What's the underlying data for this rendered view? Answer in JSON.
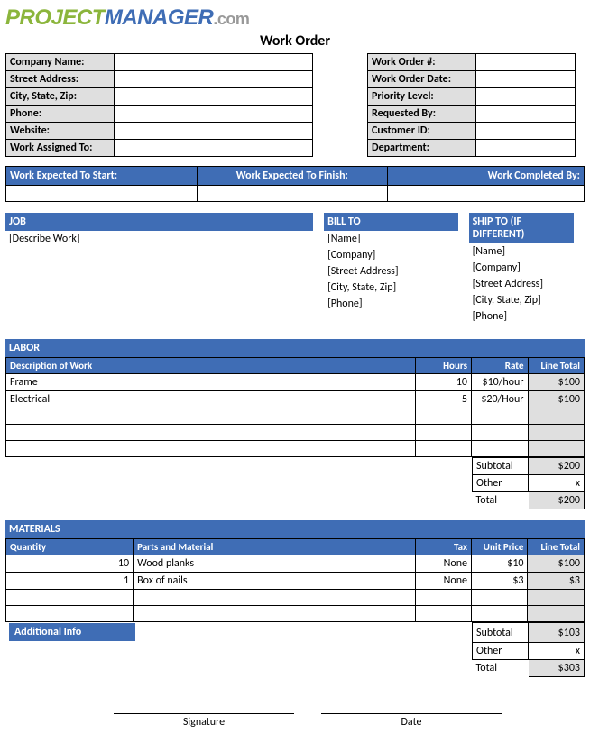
{
  "logo": {
    "p1": "PROJECT",
    "p2": "MANAGER",
    "p3": ".com"
  },
  "title": "Work Order",
  "left_info": [
    {
      "label": "Company Name:",
      "value": ""
    },
    {
      "label": "Street Address:",
      "value": ""
    },
    {
      "label": "City, State, Zip:",
      "value": ""
    },
    {
      "label": "Phone:",
      "value": ""
    },
    {
      "label": "Website:",
      "value": ""
    },
    {
      "label": "Work Assigned To:",
      "value": ""
    }
  ],
  "right_info": [
    {
      "label": "Work Order #:",
      "value": ""
    },
    {
      "label": "Work Order Date:",
      "value": ""
    },
    {
      "label": "Priority Level:",
      "value": ""
    },
    {
      "label": "Requested By:",
      "value": ""
    },
    {
      "label": "Customer ID:",
      "value": ""
    },
    {
      "label": "Department:",
      "value": ""
    }
  ],
  "timeline": {
    "h1": "Work Expected To Start:",
    "h2": "Work Expected To Finish:",
    "h3": "Work Completed By:"
  },
  "job": {
    "header": "JOB",
    "line": "[Describe Work]"
  },
  "billto": {
    "header": "BILL TO",
    "l1": "[Name]",
    "l2": "[Company]",
    "l3": "[Street Address]",
    "l4": "[City, State, Zip]",
    "l5": "[Phone]"
  },
  "shipto": {
    "header": "SHIP TO (IF DIFFERENT)",
    "l1": "[Name]",
    "l2": "[Company]",
    "l3": "[Street Address]",
    "l4": "[City, State, Zip]",
    "l5": "[Phone]"
  },
  "labor": {
    "title": "LABOR",
    "cols": {
      "desc": "Description of Work",
      "hours": "Hours",
      "rate": "Rate",
      "total": "Line Total"
    },
    "rows": [
      {
        "desc": "Frame",
        "hours": "10",
        "rate": "$10/hour",
        "total": "$100"
      },
      {
        "desc": "Electrical",
        "hours": "5",
        "rate": "$20/Hour",
        "total": "$100"
      }
    ],
    "subtotal_label": "Subtotal",
    "subtotal": "$200",
    "other_label": "Other",
    "other": "x",
    "total_label": "Total",
    "total": "$200"
  },
  "materials": {
    "title": "MATERIALS",
    "cols": {
      "qty": "Quantity",
      "parts": "Parts and Material",
      "tax": "Tax",
      "price": "Unit Price",
      "total": "Line Total"
    },
    "rows": [
      {
        "qty": "10",
        "parts": "Wood planks",
        "tax": "None",
        "price": "$10",
        "total": "$100"
      },
      {
        "qty": "1",
        "parts": "Box of nails",
        "tax": "None",
        "price": "$3",
        "total": "$3"
      }
    ],
    "subtotal_label": "Subtotal",
    "subtotal": "$103",
    "other_label": "Other",
    "other": "x",
    "total_label": "Total",
    "total": "$303"
  },
  "additional_info": "Additional Info",
  "sig": {
    "signature": "Signature",
    "date": "Date"
  }
}
